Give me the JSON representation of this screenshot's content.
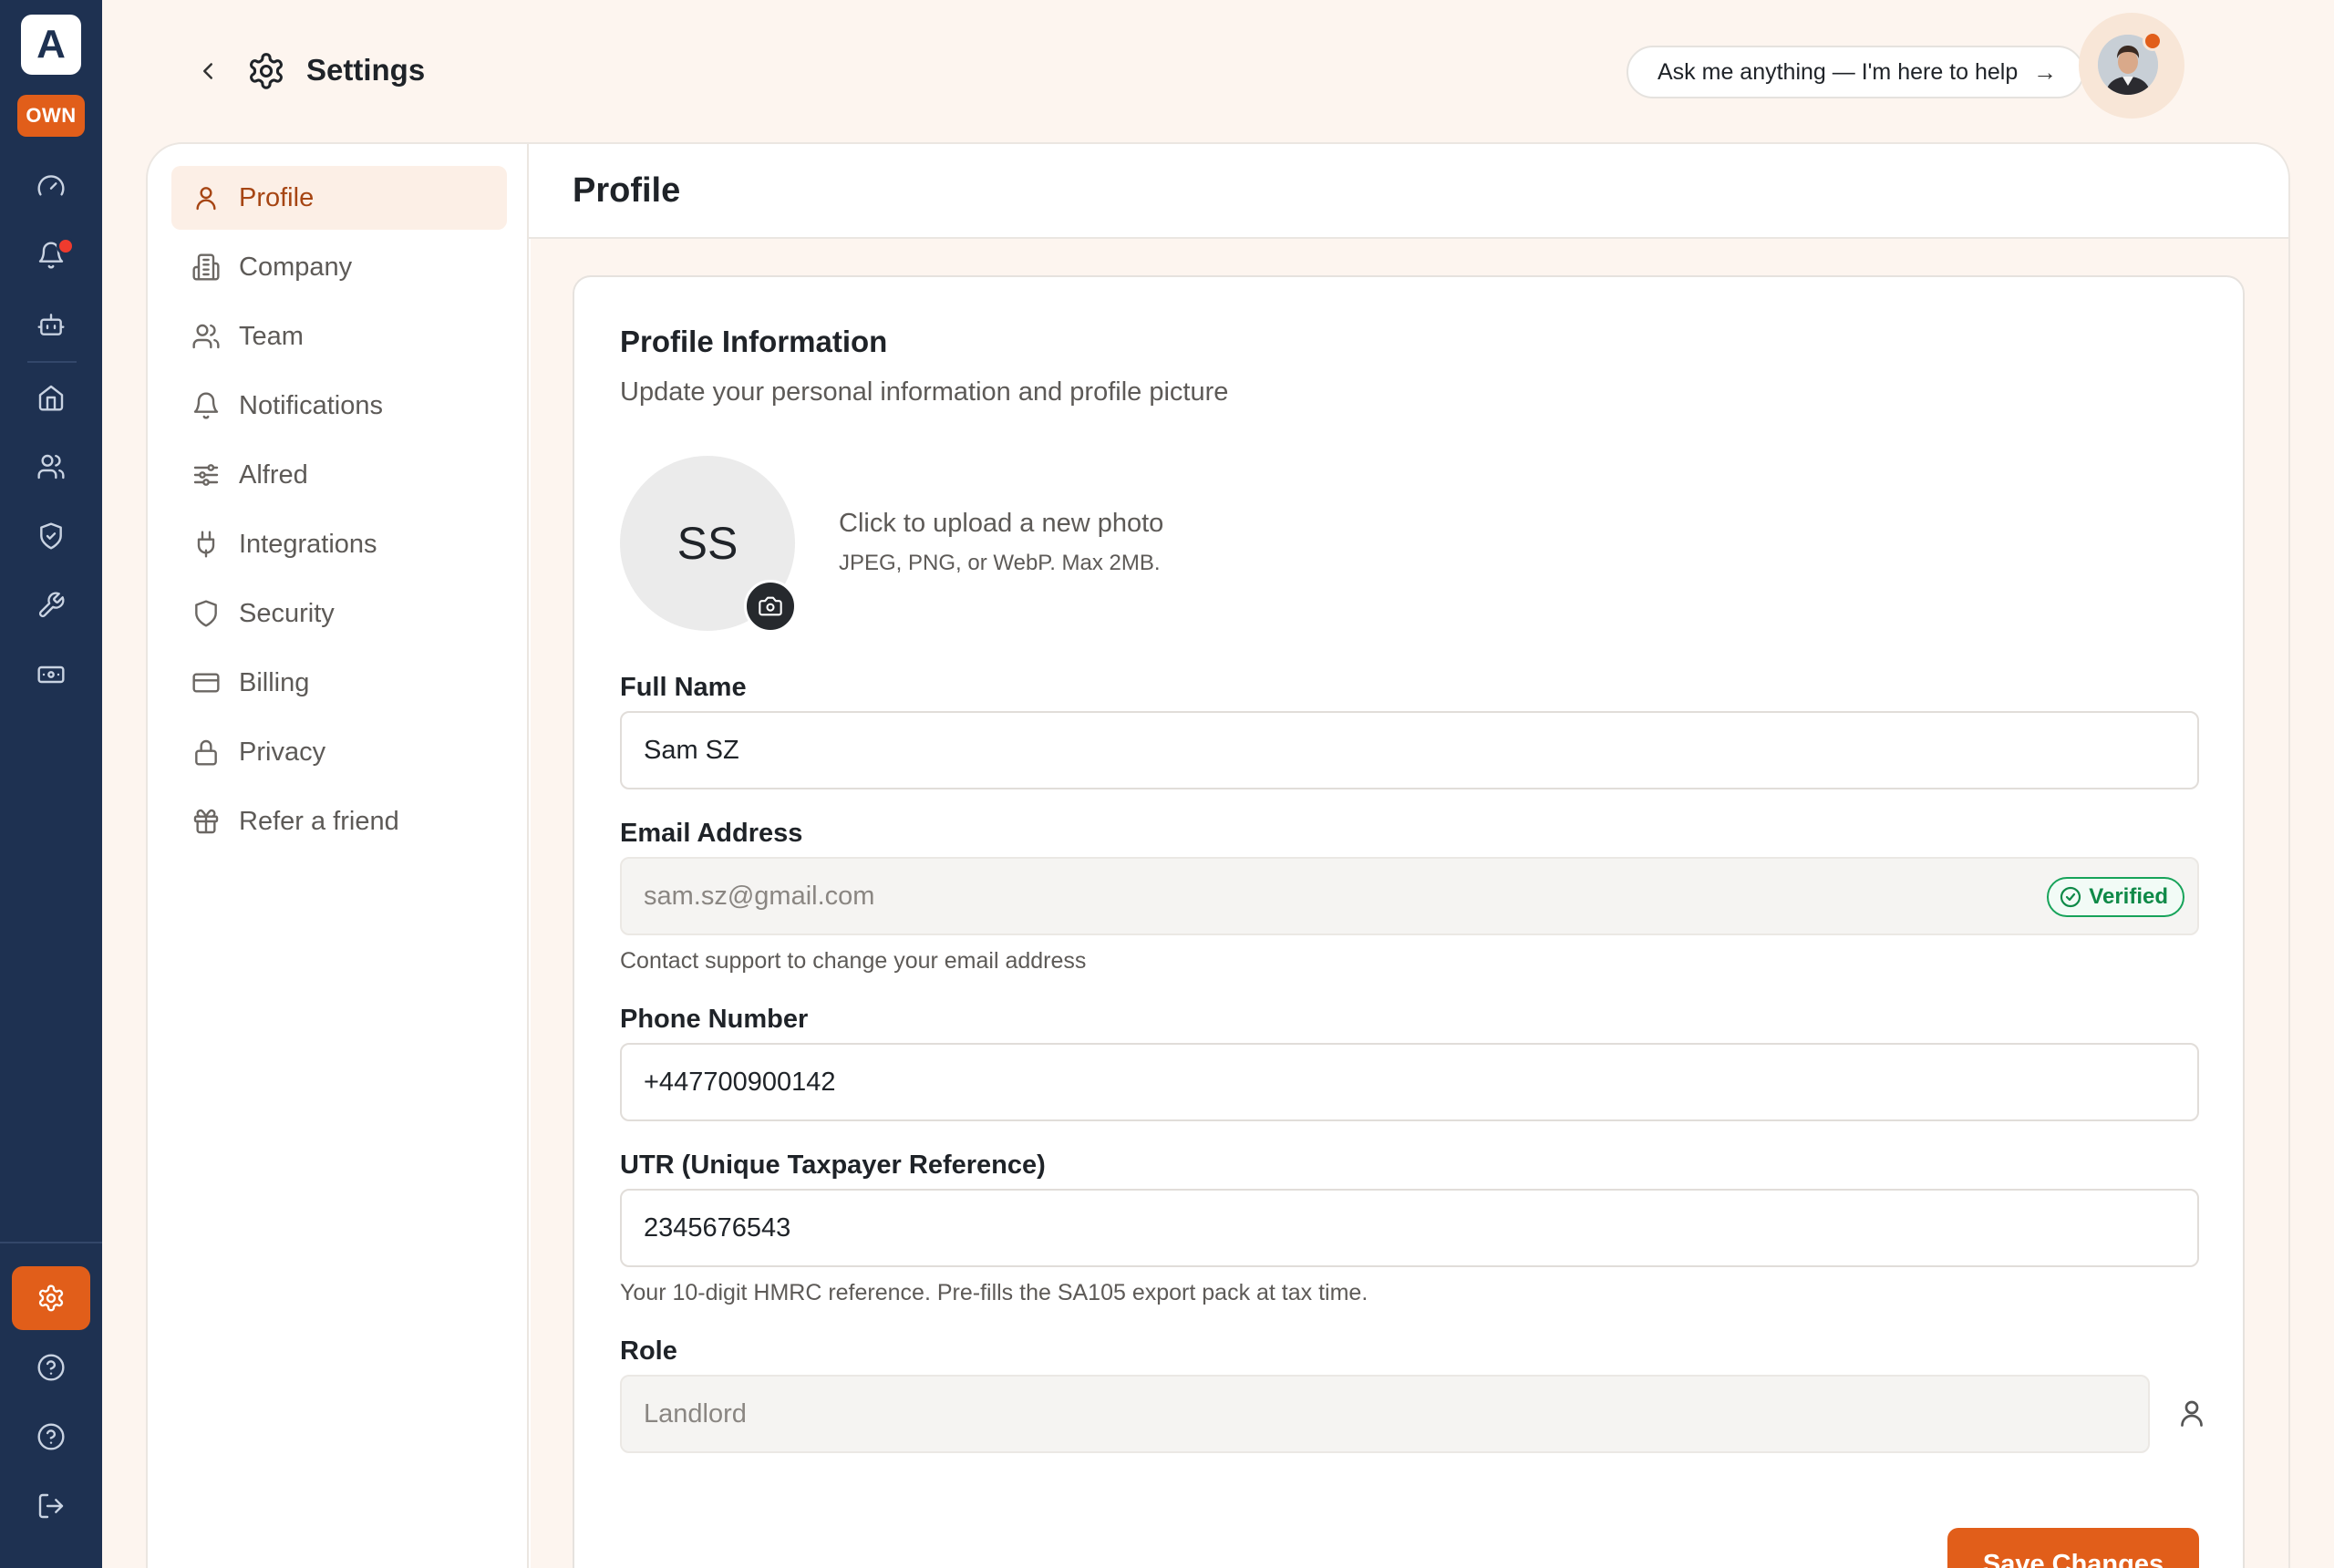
{
  "brand": {
    "logo_letter": "A",
    "badge": "OWN"
  },
  "rail": {
    "items": [
      {
        "icon": "gauge-icon"
      },
      {
        "icon": "bell-icon"
      },
      {
        "icon": "bot-icon"
      },
      {
        "icon": "home-icon"
      },
      {
        "icon": "users-icon"
      },
      {
        "icon": "shield-check-icon"
      },
      {
        "icon": "wrench-icon"
      },
      {
        "icon": "banknote-icon"
      }
    ],
    "bottom": [
      {
        "icon": "gear-icon",
        "active": true
      },
      {
        "icon": "help-circle-icon"
      },
      {
        "icon": "help-circle-icon"
      },
      {
        "icon": "logout-icon"
      }
    ]
  },
  "header": {
    "title": "Settings",
    "assistant_prompt": "Ask me anything — I'm here to help",
    "assistant_arrow": "→"
  },
  "subnav": {
    "items": [
      {
        "label": "Profile",
        "icon": "user-icon",
        "active": true
      },
      {
        "label": "Company",
        "icon": "building-icon"
      },
      {
        "label": "Team",
        "icon": "users-icon"
      },
      {
        "label": "Notifications",
        "icon": "bell-icon"
      },
      {
        "label": "Alfred",
        "icon": "sliders-icon"
      },
      {
        "label": "Integrations",
        "icon": "plug-icon"
      },
      {
        "label": "Security",
        "icon": "shield-icon"
      },
      {
        "label": "Billing",
        "icon": "credit-card-icon"
      },
      {
        "label": "Privacy",
        "icon": "lock-icon"
      },
      {
        "label": "Refer a friend",
        "icon": "gift-icon"
      }
    ]
  },
  "content": {
    "title": "Profile",
    "card": {
      "title": "Profile Information",
      "subtitle": "Update your personal information and profile picture",
      "photo": {
        "initials": "SS",
        "upload_title": "Click to upload a new photo",
        "upload_hint": "JPEG, PNG, or WebP. Max 2MB."
      },
      "full_name": {
        "label": "Full Name",
        "value": "Sam SZ"
      },
      "email": {
        "label": "Email Address",
        "value": "sam.sz@gmail.com",
        "badge": "Verified",
        "help": "Contact support to change your email address"
      },
      "phone": {
        "label": "Phone Number",
        "value": "+447700900142"
      },
      "utr": {
        "label": "UTR (Unique Taxpayer Reference)",
        "value": "2345676543",
        "help": "Your 10-digit HMRC reference. Pre-fills the SA105 export pack at tax time."
      },
      "role": {
        "label": "Role",
        "value": "Landlord"
      },
      "save_label": "Save Changes"
    }
  },
  "colors": {
    "accent": "#e15e1a",
    "rail_bg": "#1e3151",
    "page_bg": "#fdf5ef",
    "verified": "#17a35a"
  }
}
